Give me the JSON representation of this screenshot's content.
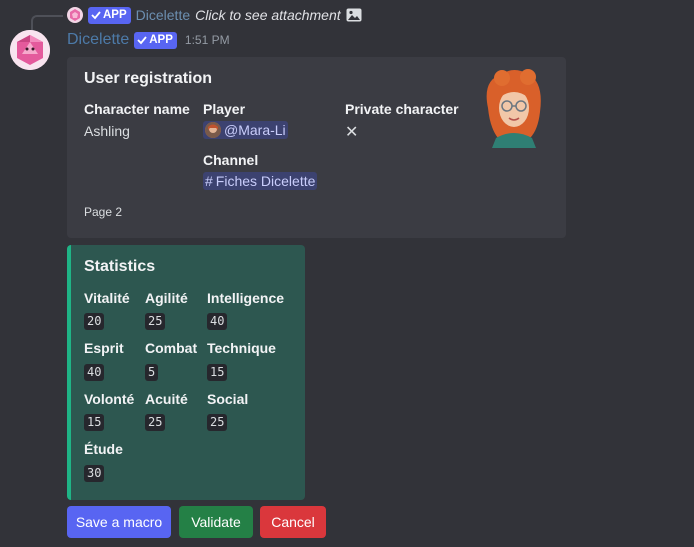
{
  "reply": {
    "app_badge": "APP",
    "author": "Dicelette",
    "text": "Click to see attachment"
  },
  "message": {
    "author": "Dicelette",
    "app_badge": "APP",
    "timestamp": "1:51 PM"
  },
  "registration_embed": {
    "title": "User registration",
    "fields": {
      "character_name": {
        "label": "Character name",
        "value": "Ashling"
      },
      "player": {
        "label": "Player",
        "value": "@Mara-Li"
      },
      "private_character": {
        "label": "Private character",
        "value": "✕"
      },
      "channel": {
        "label": "Channel",
        "value": "Fiches Dicelette",
        "prefix": "#"
      }
    },
    "footer": "Page 2"
  },
  "stats_embed": {
    "title": "Statistics",
    "accent_color": "#1fb486",
    "stats": [
      {
        "label": "Vitalité",
        "value": "20"
      },
      {
        "label": "Agilité",
        "value": "25"
      },
      {
        "label": "Intelligence",
        "value": "40"
      },
      {
        "label": "Esprit",
        "value": "40"
      },
      {
        "label": "Combat",
        "value": "5"
      },
      {
        "label": "Technique",
        "value": "15"
      },
      {
        "label": "Volonté",
        "value": "15"
      },
      {
        "label": "Acuité",
        "value": "25"
      },
      {
        "label": "Social",
        "value": "25"
      },
      {
        "label": "Étude",
        "value": "30"
      }
    ]
  },
  "buttons": {
    "save_macro": "Save a macro",
    "validate": "Validate",
    "cancel": "Cancel"
  },
  "colors": {
    "blurple": "#5865f2",
    "success": "#248046",
    "danger": "#da373c"
  }
}
